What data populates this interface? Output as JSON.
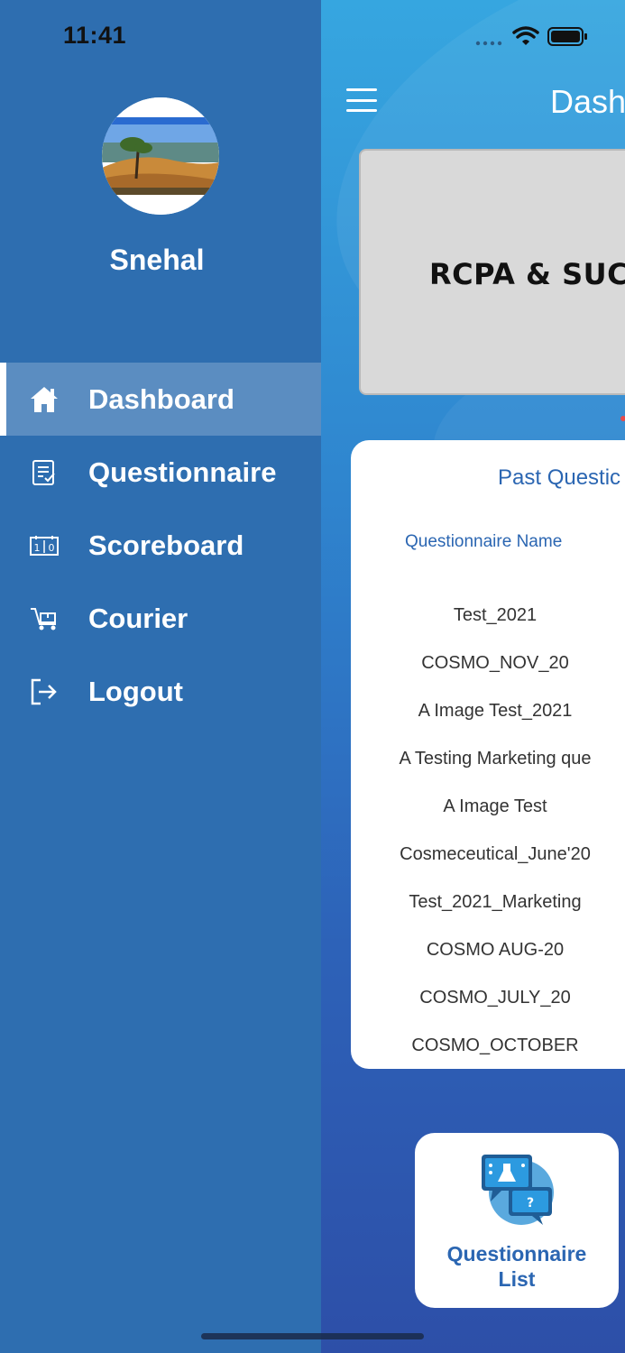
{
  "status_bar": {
    "time": "11:41"
  },
  "drawer": {
    "user_name": "Snehal",
    "menu": [
      {
        "label": "Dashboard",
        "icon": "home-icon",
        "active": true
      },
      {
        "label": "Questionnaire",
        "icon": "questionnaire-icon",
        "active": false
      },
      {
        "label": "Scoreboard",
        "icon": "scoreboard-icon",
        "active": false
      },
      {
        "label": "Courier",
        "icon": "courier-icon",
        "active": false
      },
      {
        "label": "Logout",
        "icon": "logout-icon",
        "active": false
      }
    ]
  },
  "main": {
    "title": "Dash",
    "banner_text": "RCPA & SUC",
    "past_card": {
      "title": "Past Questic",
      "column_header": "Questionnaire Name",
      "rows": [
        "Test_2021",
        "COSMO_NOV_20",
        "A Image Test_2021",
        "A Testing Marketing que",
        "A Image Test",
        "Cosmeceutical_June'20",
        "Test_2021_Marketing",
        "COSMO AUG-20",
        "COSMO_JULY_20",
        "COSMO_OCTOBER"
      ]
    },
    "fab": {
      "label_line1": "Questionnaire",
      "label_line2": "List"
    }
  },
  "colors": {
    "drawer_bg": "#2e6eb0",
    "accent_text": "#2b66b2",
    "banner_bg": "#d9d9d9"
  }
}
